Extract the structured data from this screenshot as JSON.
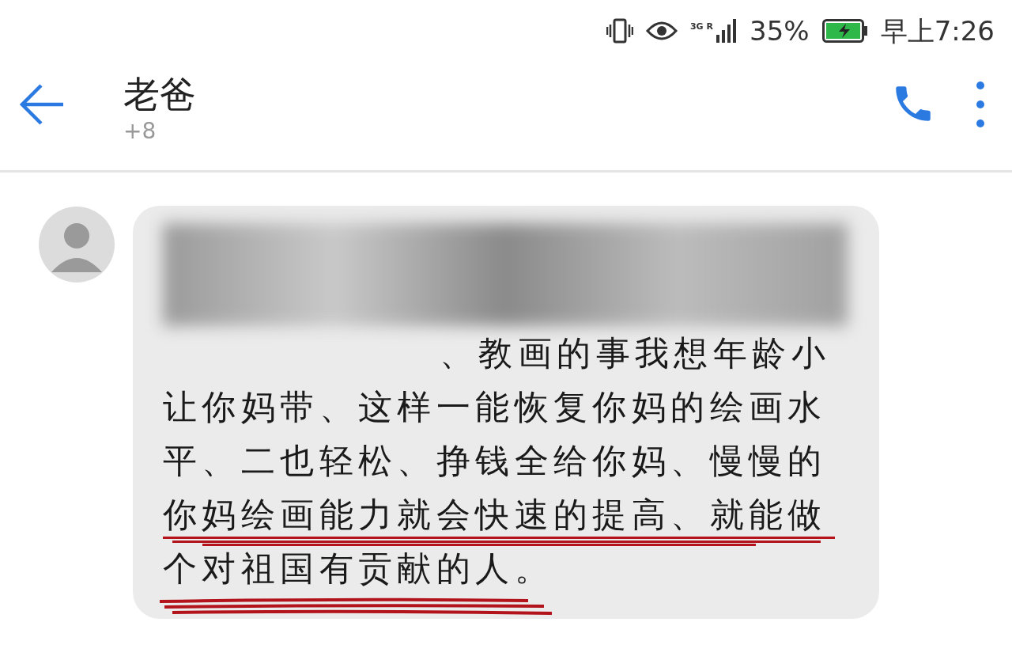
{
  "status_bar": {
    "network": "3G",
    "roaming": "R",
    "battery": "35%",
    "time": "早上7:26"
  },
  "header": {
    "title": "老爸",
    "subtitle": "+8"
  },
  "messages": [
    {
      "text": "、教画的事我想年龄小让你妈带、这样一能恢复你妈的绘画水平、二也轻松、挣钱全给你妈、慢慢的你妈绘画能力就会快速的提高、就能做个对祖国有贡献的人。",
      "redacted": true
    }
  ]
}
